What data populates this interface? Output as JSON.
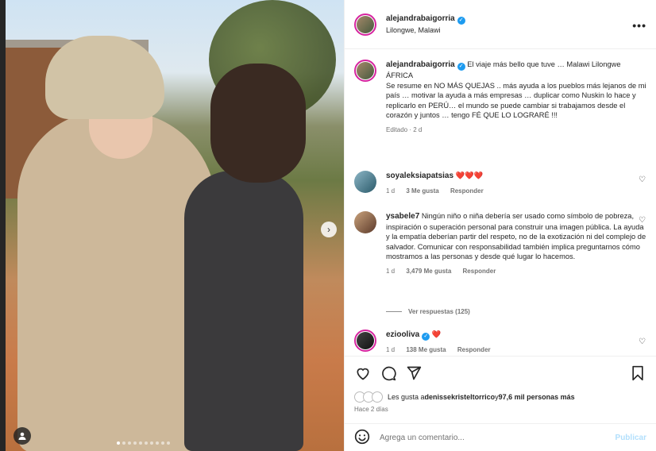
{
  "post": {
    "username": "alejandrabaigorria",
    "location": "Lilongwe, Malawi",
    "caption": "El viaje más bello que tuve … Malawi Lilongwe ÁFRICA\nSe resume en NO MÁS QUEJAS .. más ayuda a los pueblos más lejanos de mi país … motivar la ayuda a más empresas … duplicar como Nuskin lo hace y replicarlo en PERÚ… el mundo se puede cambiar si trabajamos desde el corazón y juntos … tengo FÉ QUE LO LOGRARÉ !!!",
    "edited": "Editado · 2 d"
  },
  "comments": [
    {
      "username": "soyaleksiapatsias",
      "text": "❤️❤️❤️",
      "age": "1 d",
      "likes": "3 Me gusta",
      "reply": "Responder"
    },
    {
      "username": "ysabele7",
      "text": "Ningún niño o niña debería ser usado como símbolo de pobreza, inspiración o superación personal para construir una imagen pública. La ayuda y la empatía deberían partir del respeto, no de la exotización ni del complejo de salvador. Comunicar con responsabilidad también implica preguntarnos cómo mostramos a las personas y desde qué lugar lo hacemos.",
      "age": "1 d",
      "likes": "3,479 Me gusta",
      "reply": "Responder",
      "view_replies": "Ver respuestas (125)"
    },
    {
      "username": "ezioolivа",
      "text": "❤️",
      "age": "1 d",
      "likes": "138 Me gusta",
      "reply": "Responder"
    }
  ],
  "likes_summary": {
    "prefix": "Les gusta a ",
    "user": "denissekristeltorrico",
    "middle": " y ",
    "count": "97,6 mil personas más"
  },
  "posted": "Hace 2 días",
  "comment_box": {
    "placeholder": "Agrega un comentario...",
    "publish": "Publicar"
  },
  "icons": [
    "more-icon",
    "heart-icon",
    "comment-icon",
    "share-icon",
    "save-icon",
    "emoji-icon",
    "next-arrow-icon",
    "user-tag-icon",
    "verified-icon"
  ],
  "colors": {
    "verified": "#1d9bf0",
    "heart": "#e0245e",
    "publish": "#b2dffc",
    "muted": "#737373"
  },
  "carousel": {
    "slides": 10,
    "active": 1
  }
}
